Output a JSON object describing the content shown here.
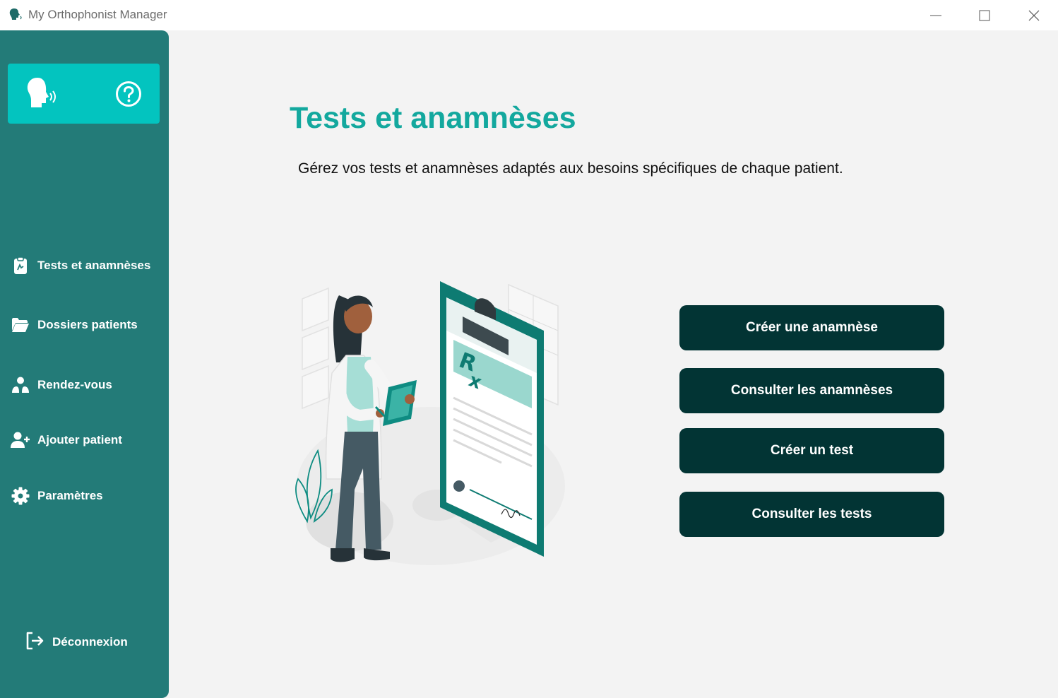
{
  "window": {
    "title": "My Orthophonist Manager"
  },
  "colors": {
    "sidebar": "#237b78",
    "logo_card": "#03c4bf",
    "title": "#13a89e",
    "button": "#023434",
    "background": "#f3f3f3"
  },
  "sidebar": {
    "logo_icon": "speaking-head-icon",
    "help_icon": "question-circle-icon",
    "items": [
      {
        "label": "Tests et anamnèses",
        "icon": "clipboard-icon"
      },
      {
        "label": "Dossiers patients",
        "icon": "folder-open-icon"
      },
      {
        "label": "Rendez-vous",
        "icon": "users-icon"
      },
      {
        "label": "Ajouter patient",
        "icon": "user-plus-icon"
      },
      {
        "label": "Paramètres",
        "icon": "gear-icon"
      }
    ],
    "logout": {
      "label": "Déconnexion",
      "icon": "logout-icon"
    }
  },
  "main": {
    "title": "Tests et anamnèses",
    "subtitle": "Gérez vos tests et anamnèses adaptés aux besoins spécifiques de chaque patient.",
    "illustration": "doctor-with-clipboard-illustration",
    "buttons": [
      {
        "label": "Créer une anamnèse"
      },
      {
        "label": "Consulter les anamnèses"
      },
      {
        "label": "Créer un test"
      },
      {
        "label": "Consulter les tests"
      }
    ]
  }
}
